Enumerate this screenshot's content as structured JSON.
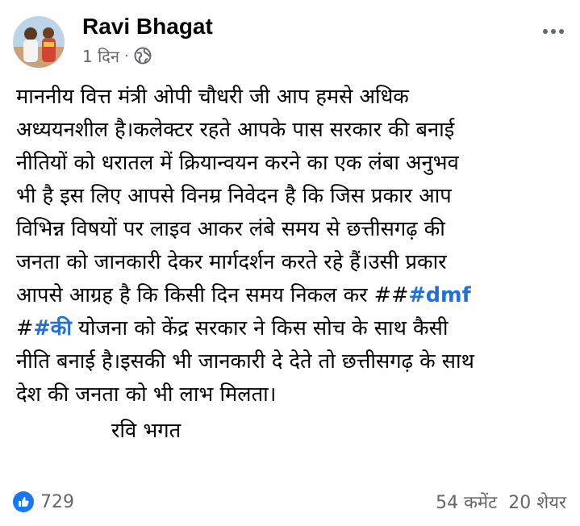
{
  "post": {
    "author": "Ravi Bhagat",
    "time": "1 दिन",
    "separator": "·",
    "body_lines": [
      "माननीय वित्त मंत्री ओपी चौधरी जी आप हमसे अधिक",
      "अध्ययनशील है।कलेक्टर रहते आपके पास सरकार की बनाई",
      "नीतियों को धरातल में क्रियान्वयन करने का एक लंबा अनुभव",
      "भी है इस लिए आपसे  विनम्र निवेदन है कि जिस प्रकार आप",
      "विभिन्न विषयों पर लाइव आकर लंबे समय से छत्तीसगढ़ की",
      "जनता को जानकारी देकर मार्गदर्शन करते रहे हैं।उसी प्रकार"
    ],
    "line7_text": "आपसे आग्रह है कि किसी दिन समय निकल कर ##",
    "hashtag_dmf": "#dmf",
    "line8_prefix": "#",
    "hashtag_ki": "#की",
    "line8_text": "  योजना को  केंद्र सरकार ने किस सोच के साथ कैसी",
    "body_lines_2": [
      "नीति बनाई है।इसकी भी जानकारी दे देते तो  छत्तीसगढ़ के साथ",
      "देश की जनता को भी लाभ मिलता।"
    ],
    "signature": "रवि भगत"
  },
  "footer": {
    "reaction_count": "729",
    "comments": "54 कमेंट",
    "shares": "20 शेयर"
  },
  "colors": {
    "hashtag": "#216fdb",
    "like": "#1877f2",
    "muted": "#65676b"
  },
  "icons": [
    "globe-icon",
    "more-icon",
    "like-icon"
  ]
}
